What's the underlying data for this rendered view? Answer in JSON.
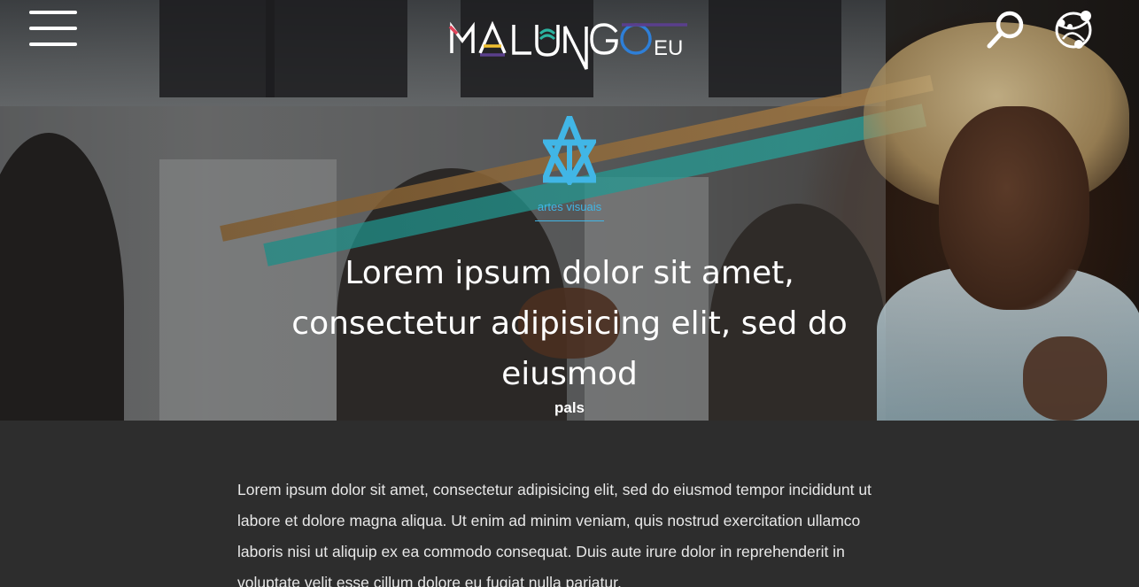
{
  "header": {
    "menu_icon": "hamburger-menu-icon",
    "logo_text": "MALUNGO",
    "logo_suffix": "EU",
    "search_icon": "search-icon",
    "globe_icon": "network-globe-icon"
  },
  "article": {
    "category_icon": "artes-visuais-icon",
    "category": "artes visuais",
    "title": "Lorem ipsum dolor sit amet, consectetur adipisicing elit, sed do eiusmod",
    "author": "pals",
    "body": "Lorem ipsum dolor sit amet, consectetur adipisicing elit, sed do eiusmod tempor incididunt ut labore et dolore magna aliqua. Ut enim ad minim veniam, quis nostrud exercitation ullamco laboris nisi ut aliquip ex ea commodo consequat. Duis aute irure dolor in reprehenderit in voluptate velit esse cillum dolore eu fugiat nulla pariatur."
  },
  "colors": {
    "accent": "#41b6e6",
    "body_background": "#2d2d2d",
    "text": "#ffffff"
  }
}
